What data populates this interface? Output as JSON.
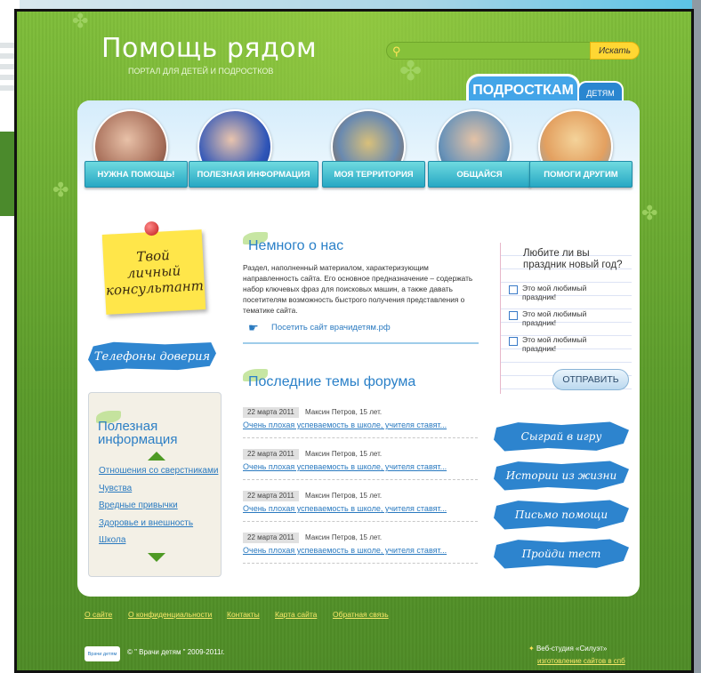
{
  "site": {
    "logo": "Помощь рядом",
    "tagline": "ПОРТАЛ ДЛЯ ДЕТЕЙ И ПОДРОСТКОВ"
  },
  "search": {
    "placeholder": "",
    "button": "Искать"
  },
  "tabs": [
    {
      "label": "ПОДРОСТКАМ",
      "active": true
    },
    {
      "label": "ДЕТЯМ",
      "active": false
    }
  ],
  "categories": [
    {
      "label": "НУЖНА ПОМОЩЬ!",
      "color": "#c7a28f"
    },
    {
      "label": "ПОЛЕЗНАЯ ИНФОРМАЦИЯ",
      "color": "#2f55b8"
    },
    {
      "label": "МОЯ ТЕРРИТОРИЯ",
      "color": "#b59e5a"
    },
    {
      "label": "ОБЩАЙСЯ",
      "color": "#9bc7d4"
    },
    {
      "label": "ПОМОГИ ДРУГИМ",
      "color": "#e3a060"
    }
  ],
  "sticky": {
    "lines": [
      "Твой",
      "личный",
      "консультант"
    ]
  },
  "hotline": "Телефоны доверия",
  "useful": {
    "title": "Полезная информация",
    "links": [
      "Отношения со сверстниками",
      "Чувства",
      "Вредные привычки",
      "Здоровье и внешность",
      "Школа"
    ]
  },
  "about": {
    "title": "Немного о нас",
    "text": "Раздел, наполненный материалом, характеризующим направленность сайта. Его основное предназначение – содержать набор ключевых фраз для поисковых машин, а также давать посетителям возможность быстрого получения представления о тематике сайта.",
    "link": "Посетить сайт врачидетям.рф"
  },
  "forum": {
    "title": "Последние темы форума",
    "items": [
      {
        "date": "22 марта 2011",
        "author": "Максин Петров, 15 лет.",
        "topic": "Очень плохая успеваемость в школе, учителя ставят..."
      },
      {
        "date": "22 марта 2011",
        "author": "Максин Петров, 15 лет.",
        "topic": "Очень плохая успеваемость в школе, учителя ставят..."
      },
      {
        "date": "22 марта 2011",
        "author": "Максин Петров, 15 лет.",
        "topic": "Очень плохая успеваемость в школе, учителя ставят..."
      },
      {
        "date": "22 марта 2011",
        "author": "Максин Петров, 15 лет.",
        "topic": "Очень плохая успеваемость в школе, учителя ставят..."
      }
    ]
  },
  "poll": {
    "question": "Любите ли вы праздник новый год?",
    "options": [
      "Это мой любимый праздник!",
      "Это мой любимый праздник!",
      "Это мой любимый праздник!"
    ],
    "submit": "ОТПРАВИТЬ"
  },
  "actions": [
    "Сыграй в игру",
    "Истории из жизни",
    "Письмо помощи",
    "Пройди тест"
  ],
  "footer": {
    "links": [
      "О сайте",
      "О конфиденциальности",
      "Контакты",
      "Карта сайта",
      "Обратная связь"
    ],
    "logo": "Врачи детям",
    "copyright": "© \" Врачи детям \" 2009-2011г.",
    "studio": "Веб-студия «Силуэт»",
    "studio_link": "изготовление сайтов в спб"
  }
}
